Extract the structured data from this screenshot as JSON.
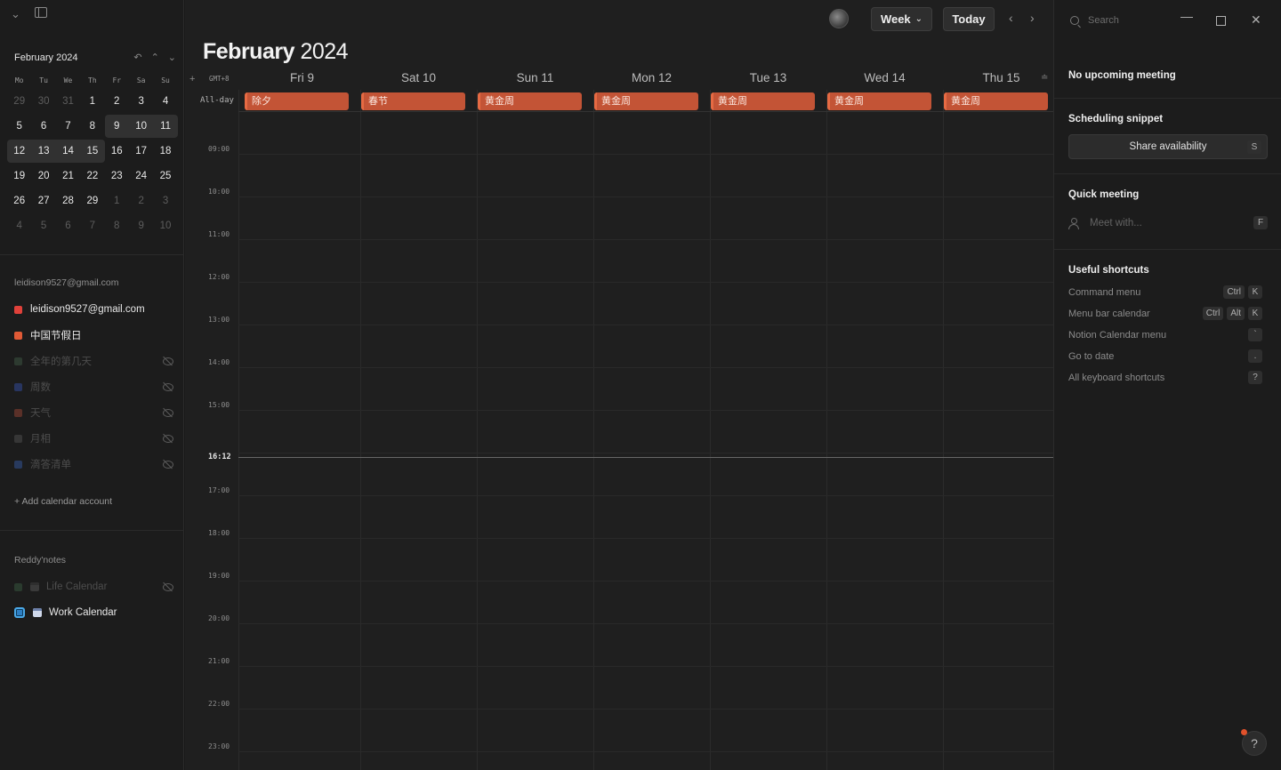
{
  "sidebar": {
    "mini": {
      "title": "February 2024",
      "dow": [
        "Mo",
        "Tu",
        "We",
        "Th",
        "Fr",
        "Sa",
        "Su"
      ],
      "weeks": [
        [
          "29",
          "30",
          "31",
          "1",
          "2",
          "3",
          "4"
        ],
        [
          "5",
          "6",
          "7",
          "8",
          "9",
          "10",
          "11"
        ],
        [
          "12",
          "13",
          "14",
          "15",
          "16",
          "17",
          "18"
        ],
        [
          "19",
          "20",
          "21",
          "22",
          "23",
          "24",
          "25"
        ],
        [
          "26",
          "27",
          "28",
          "29",
          "1",
          "2",
          "3"
        ],
        [
          "4",
          "5",
          "6",
          "7",
          "8",
          "9",
          "10"
        ]
      ]
    },
    "account_label": "leidison9527@gmail.com",
    "calendars": [
      {
        "label": "leidison9527@gmail.com",
        "color": "#e0413a"
      },
      {
        "label": "中国节假日",
        "color": "#e05a36"
      },
      {
        "label": "全年的第几天",
        "color": "#3a4f3f"
      },
      {
        "label": "周数",
        "color": "#2e3d6b"
      },
      {
        "label": "天气",
        "color": "#6b3a30"
      },
      {
        "label": "月相",
        "color": "#3e3e3e"
      },
      {
        "label": "滴答清单",
        "color": "#2e3f66"
      }
    ],
    "add_account": "Add calendar account",
    "notes_label": "Reddy'notes",
    "notes_calendars": [
      {
        "label": "Life Calendar",
        "color": "#2f4434"
      },
      {
        "label": "Work Calendar",
        "color": "#2d7fc4"
      }
    ]
  },
  "main": {
    "title_month": "February",
    "title_year": "2024",
    "view_label": "Week",
    "today_label": "Today",
    "timezone": "GMT+8",
    "allday_label": "All-day",
    "days": [
      "Fri 9",
      "Sat 10",
      "Sun 11",
      "Mon 12",
      "Tue 13",
      "Wed 14",
      "Thu 15"
    ],
    "events": [
      "除夕",
      "春节",
      "黄金周",
      "黄金周",
      "黄金周",
      "黄金周",
      "黄金周"
    ],
    "hours": [
      "09:00",
      "10:00",
      "11:00",
      "12:00",
      "13:00",
      "14:00",
      "15:00",
      "17:00",
      "18:00",
      "19:00",
      "20:00",
      "21:00",
      "22:00",
      "23:00"
    ],
    "now": "16:12"
  },
  "right": {
    "search_placeholder": "Search",
    "no_meeting": "No upcoming meeting",
    "scheduling_title": "Scheduling snippet",
    "share_label": "Share availability",
    "share_key": "S",
    "quick_title": "Quick meeting",
    "meet_placeholder": "Meet with...",
    "meet_key": "F",
    "shortcuts_title": "Useful shortcuts",
    "shortcuts": [
      {
        "label": "Command menu",
        "keys": [
          "Ctrl",
          "K"
        ]
      },
      {
        "label": "Menu bar calendar",
        "keys": [
          "Ctrl",
          "Alt",
          "K"
        ]
      },
      {
        "label": "Notion Calendar menu",
        "keys": [
          "`"
        ]
      },
      {
        "label": "Go to date",
        "keys": [
          "."
        ]
      },
      {
        "label": "All keyboard shortcuts",
        "keys": [
          "?"
        ]
      }
    ],
    "help": "?"
  }
}
